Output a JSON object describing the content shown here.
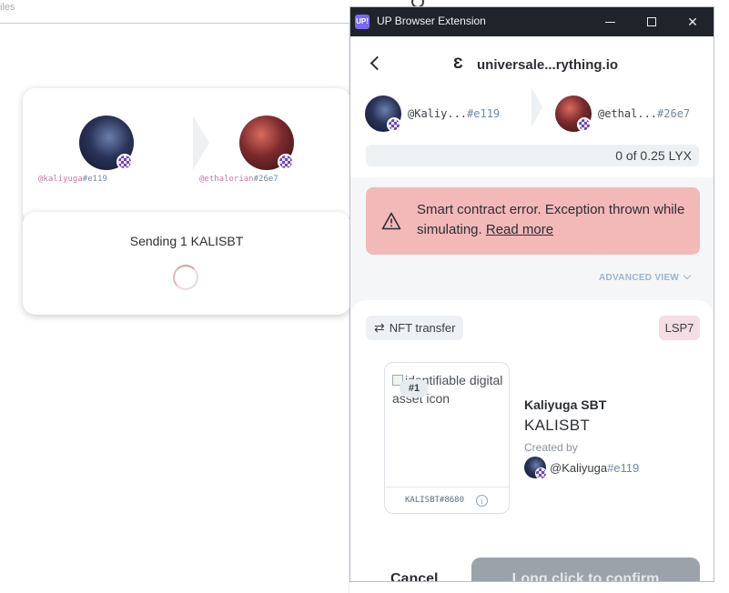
{
  "background_page": {
    "search_placeholder": "iles",
    "transfer": {
      "from": {
        "name": "@kaliyuga",
        "hash": "#e119"
      },
      "to": {
        "name": "@ethalorian",
        "hash": "#26e7"
      }
    },
    "sending_label": "Sending 1 KALISBT"
  },
  "extension": {
    "window_title": "UP Browser Extension",
    "app_icon_text": "UP!",
    "site": "universale...rything.io",
    "from": {
      "name": "@Kaliy...",
      "hash": "#e119"
    },
    "to": {
      "name": "@ethal...",
      "hash": "#26e7"
    },
    "amount": {
      "text": "0 of 0.25 LYX",
      "fraction": 0.0
    },
    "error": {
      "message": "Smart contract error. Exception thrown while simulating.",
      "link": "Read more"
    },
    "advanced_view": "ADVANCED VIEW",
    "transfer_type": "NFT transfer",
    "standard": "LSP7",
    "asset": {
      "image_alt": "identifiable digital asset icon",
      "number": "#1",
      "code": "KALISBT#8680",
      "name": "Kaliyuga SBT",
      "symbol": "KALISBT",
      "created_by_label": "Created by",
      "creator": {
        "name": "@Kaliyuga",
        "hash": "#e119"
      }
    },
    "cancel_label": "Cancel",
    "confirm_label": "Long click to confirm"
  },
  "colors": {
    "error_bg": "#f3b8b8",
    "lsp_chip": "#f4dde3",
    "handle_hash": "#6e88a8",
    "titlebar": "#20232a",
    "confirm_disabled": "#9ba2a9"
  }
}
